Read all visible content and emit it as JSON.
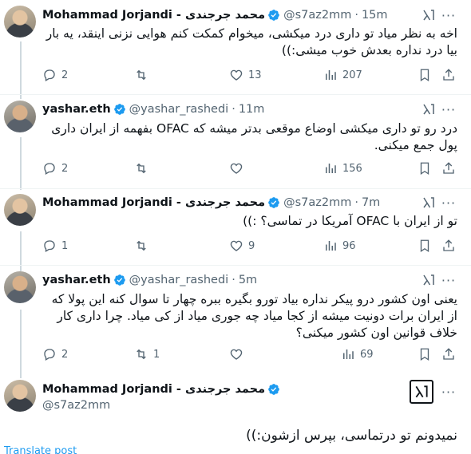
{
  "tweets": [
    {
      "name": "Mohammad Jorjandi - محمد جرجندی",
      "handle": "@s7az2mm",
      "time": "15m",
      "text": "اخه به نظر میاد تو داری درد میکشی، میخوام کمکت کنم هوایی نزنی اینقد، یه بار بیا درد نداره بعدش خوب میشی:))",
      "replies": "2",
      "retweets": "",
      "likes": "13",
      "views": "207"
    },
    {
      "name": "yashar.eth",
      "handle": "@yashar_rashedi",
      "time": "11m",
      "text": "درد رو تو داری میکشی اوضاع موقعی بدتر میشه که OFAC بفهمه از ایران داری پول جمع میکنی.",
      "replies": "2",
      "retweets": "",
      "likes": "",
      "views": "156"
    },
    {
      "name": "Mohammad Jorjandi - محمد جرجندی",
      "handle": "@s7az2mm",
      "time": "7m",
      "text": "تو از ایران با OFAC آمریکا در تماسی؟ :))",
      "replies": "1",
      "retweets": "",
      "likes": "9",
      "views": "96"
    },
    {
      "name": "yashar.eth",
      "handle": "@yashar_rashedi",
      "time": "5m",
      "text": "یعنی اون کشور درو پیکر نداره بیاد تورو بگیره ببره چهار تا سوال کنه این پولا که از ایران برات دونیت میشه از کجا میاد چه جوری میاد از کی میاد. چرا داری کار خلاف قوانین اون کشور میکنی؟",
      "replies": "2",
      "retweets": "1",
      "likes": "",
      "views": "69"
    }
  ],
  "main_tweet": {
    "name": "Mohammad Jorjandi - محمد جرجندی",
    "handle": "@s7az2mm",
    "text": "نمیدونم تو درتماسی، بپرس ازشون:))",
    "translate_label": "Translate post"
  },
  "separator": "·",
  "icons": {
    "verified": "verified-badge-icon",
    "grok": "grok-icon",
    "more": "more-options-icon",
    "reply": "reply-icon",
    "retweet": "retweet-icon",
    "like": "heart-icon",
    "views": "views-icon",
    "bookmark": "bookmark-icon",
    "share": "share-icon"
  },
  "colors": {
    "accent": "#1d9bf0",
    "text_primary": "#0f1419",
    "text_secondary": "#536471",
    "divider": "#eff3f4"
  }
}
